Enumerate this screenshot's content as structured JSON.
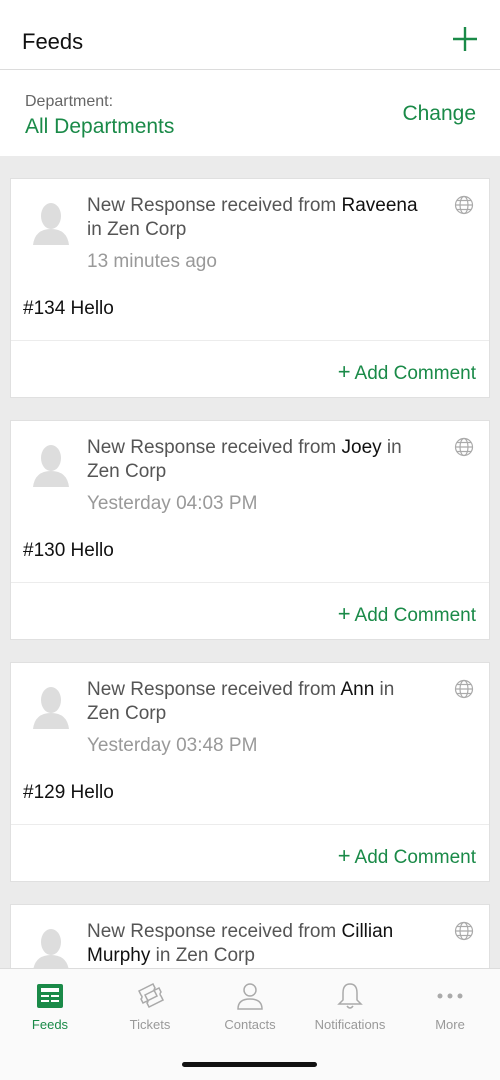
{
  "header": {
    "title": "Feeds",
    "add_icon": "plus-icon"
  },
  "department": {
    "label": "Department:",
    "value": "All Departments",
    "change_label": "Change"
  },
  "colors": {
    "accent": "#1a8a48",
    "muted": "#999999"
  },
  "feed": [
    {
      "prefix": "New Response received from ",
      "name": "Raveena",
      "suffix": " in Zen Corp",
      "time": "13 minutes ago",
      "body": "#134 Hello",
      "add_comment": "Add Comment"
    },
    {
      "prefix": "New Response received from ",
      "name": "Joey",
      "suffix": " in Zen Corp",
      "time": "Yesterday 04:03 PM",
      "body": "#130 Hello",
      "add_comment": "Add Comment"
    },
    {
      "prefix": "New Response received from ",
      "name": "Ann",
      "suffix": " in Zen Corp",
      "time": "Yesterday 03:48 PM",
      "body": "#129 Hello",
      "add_comment": "Add Comment"
    },
    {
      "prefix": "New Response received from ",
      "name": "Cillian Murphy",
      "suffix": " in Zen Corp",
      "time": "",
      "body": "",
      "add_comment": ""
    }
  ],
  "tabs": [
    {
      "label": "Feeds",
      "icon": "feeds-icon",
      "active": true
    },
    {
      "label": "Tickets",
      "icon": "tickets-icon",
      "active": false
    },
    {
      "label": "Contacts",
      "icon": "contacts-icon",
      "active": false
    },
    {
      "label": "Notifications",
      "icon": "bell-icon",
      "active": false
    },
    {
      "label": "More",
      "icon": "more-icon",
      "active": false
    }
  ]
}
